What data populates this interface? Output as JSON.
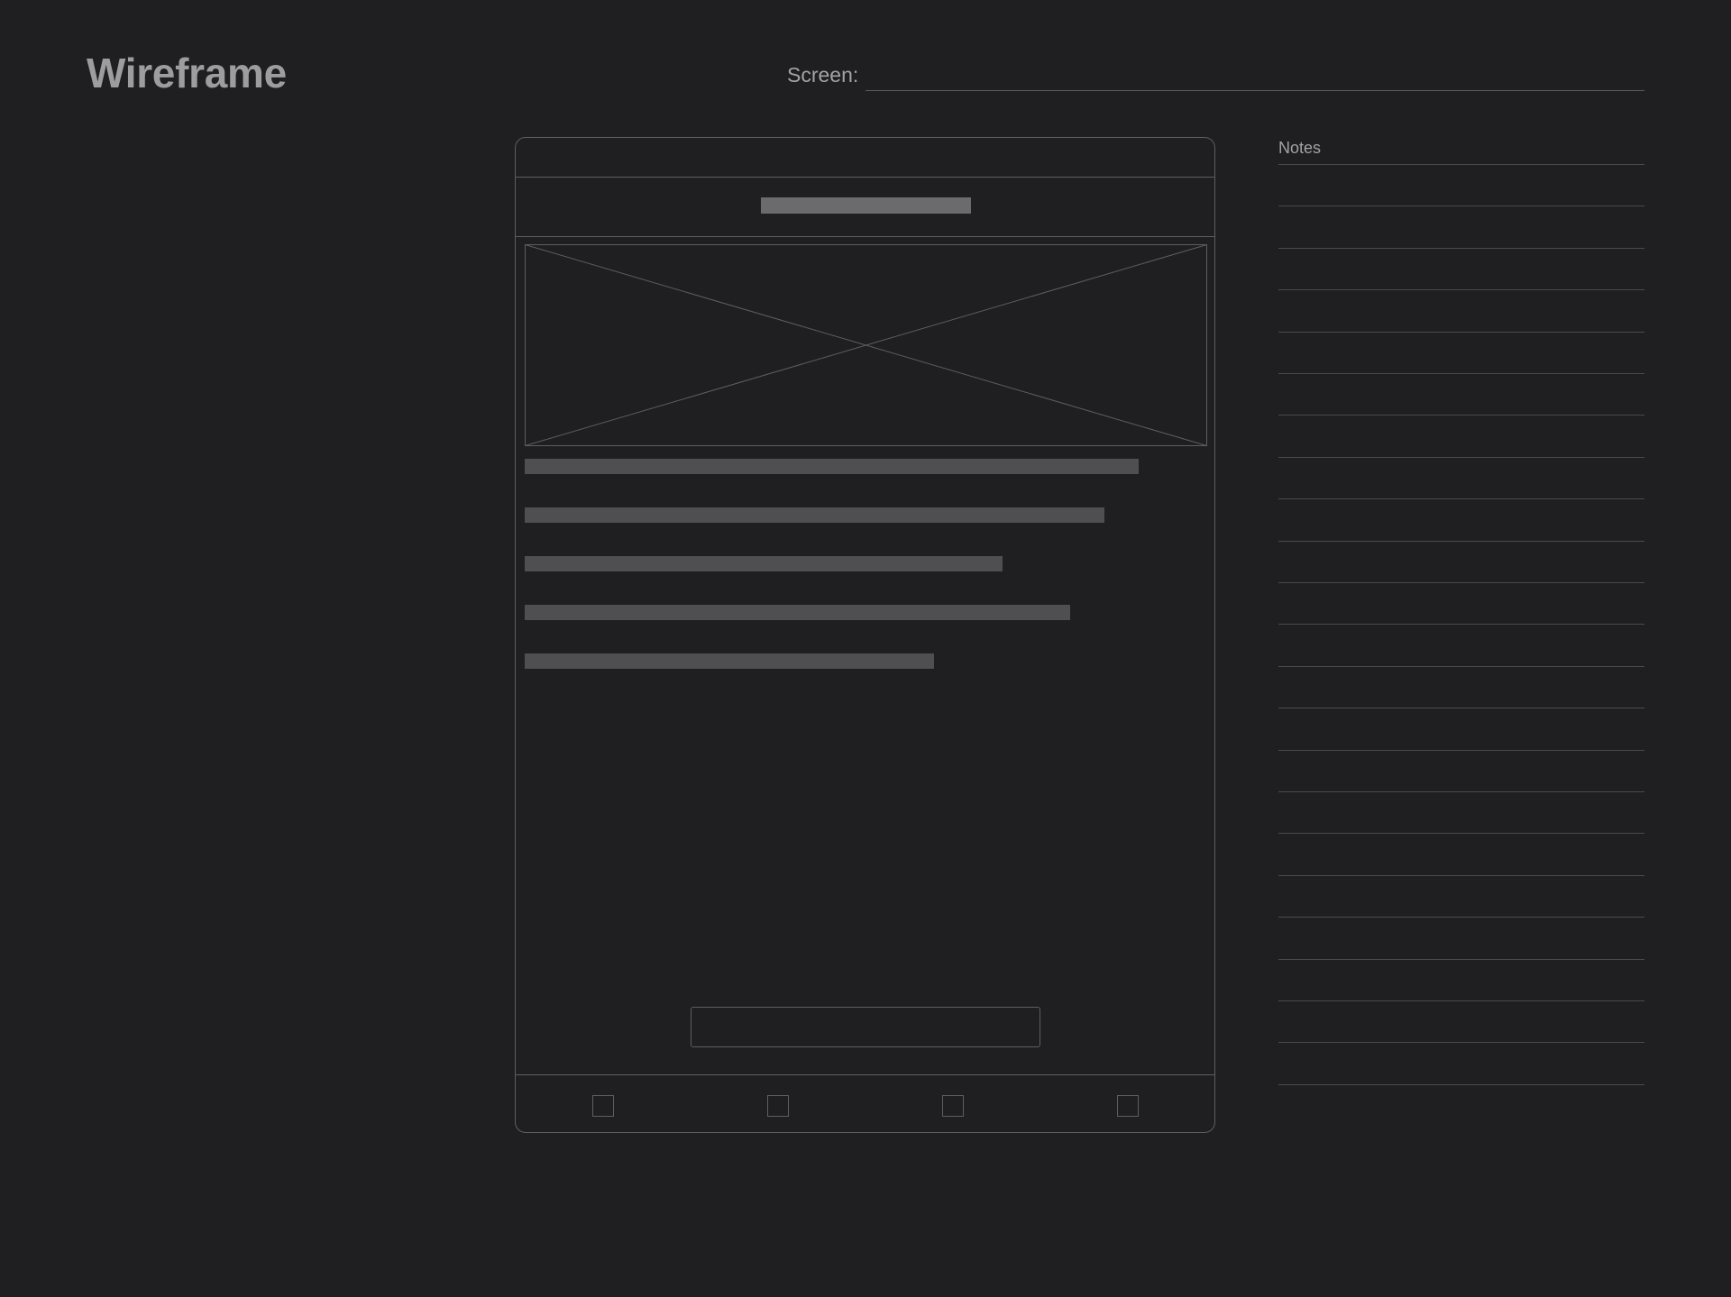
{
  "header": {
    "title": "Wireframe",
    "screen_label": "Screen:"
  },
  "notes": {
    "label": "Notes",
    "line_count": 23
  },
  "phone": {
    "hero_image_icon": "image-placeholder-icon",
    "text_line_count": 5,
    "tab_count": 4
  },
  "colors": {
    "background": "#1f1f21",
    "outline": "#5e5e60",
    "text_placeholder": "#4f4f51",
    "title_placeholder": "#6b6b6d"
  }
}
